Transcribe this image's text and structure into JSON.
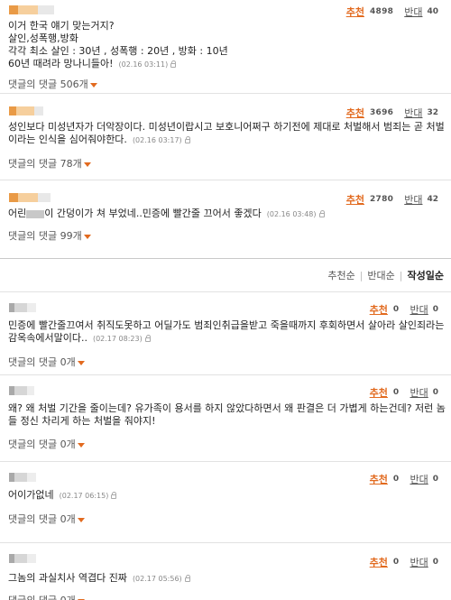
{
  "best_comments": [
    {
      "lines": [
        "이거 한국 얘기 맞는거지?",
        "살인,성폭행,방화",
        "각각 최소 살인 : 30년 , 성폭행 : 20년 , 방화 : 10년",
        "60년 때려라 망나니들아!"
      ],
      "time": "(02.16 03:11)",
      "up_label": "추천",
      "up_count": "4898",
      "down_label": "반대",
      "down_count": "40",
      "replies_label": "댓글의 댓글 506개"
    },
    {
      "lines": [
        "성인보다 미성년자가 더악장이다. 미성년이랍시고 보호니어쩌구 하기전에 제대로 처벌해서 범죄는 곧 처벌",
        "이라는 인식을 심어줘야한다."
      ],
      "time": "(02.16 03:17)",
      "up_label": "추천",
      "up_count": "3696",
      "down_label": "반대",
      "down_count": "32",
      "replies_label": "댓글의 댓글 78개"
    },
    {
      "lines_prefix": "어린",
      "lines_suffix": "이 간덩이가 쳐 부었네..민증에 빨간줄 끄어서 좋겠다",
      "time": "(02.16 03:48)",
      "up_label": "추천",
      "up_count": "2780",
      "down_label": "반대",
      "down_count": "42",
      "replies_label": "댓글의 댓글 99개"
    }
  ],
  "sort": {
    "options": [
      "추천순",
      "반대순",
      "작성일순"
    ]
  },
  "comments": [
    {
      "lines": [
        "민증에 빨간줄끄여서 취직도못하고 어딜가도 범죄인취급을받고 죽을때까지 후회하면서 살아라 살인죄라는",
        "감옥속에서말이다.."
      ],
      "time": "(02.17 08:23)",
      "up_label": "추천",
      "up_count": "0",
      "down_label": "반대",
      "down_count": "0",
      "replies_label": "댓글의 댓글 0개"
    },
    {
      "lines": [
        "왜? 왜 처벌 기간을 줄이는데? 유가족이 용서를 하지 않았다하면서 왜 판결은 더 가볍게 하는건데? 저런 놈",
        "들 정신 차리게 하는 처벌을 줘야지!"
      ],
      "time": "(02.17 06:25)",
      "up_label": "추천",
      "up_count": "0",
      "down_label": "반대",
      "down_count": "0",
      "replies_label": "댓글의 댓글 0개"
    },
    {
      "lines": [
        "어이가없네"
      ],
      "time": "(02.17 06:15)",
      "up_label": "추천",
      "up_count": "0",
      "down_label": "반대",
      "down_count": "0",
      "replies_label": "댓글의 댓글 0개"
    },
    {
      "lines": [
        "그놈의 과실치사 역겹다 진짜"
      ],
      "time": "(02.17 05:56)",
      "up_label": "추천",
      "up_count": "0",
      "down_label": "반대",
      "down_count": "0",
      "replies_label": "댓글의 댓글 0개"
    }
  ],
  "colors": {
    "accent": "#e26a1f",
    "nick_blur": "#f0b46e",
    "redact": "#c8c8c8"
  }
}
